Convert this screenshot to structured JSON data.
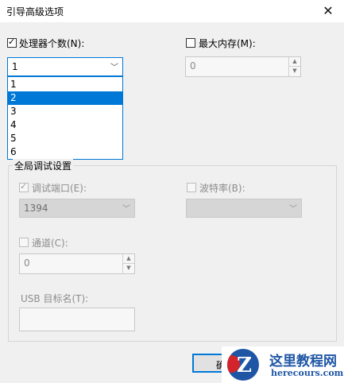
{
  "window": {
    "title": "引导高级选项",
    "close_glyph": "✕"
  },
  "processors": {
    "checkbox_label": "处理器个数(N):",
    "checked": true,
    "selected_value": "1",
    "options": [
      "1",
      "2",
      "3",
      "4",
      "5",
      "6"
    ],
    "highlighted_option": "2"
  },
  "max_memory": {
    "checkbox_label": "最大内存(M):",
    "checked": false,
    "value": "0"
  },
  "debug": {
    "group_title": "全局调试设置",
    "port_label": "调试端口(E):",
    "port_checked": true,
    "port_value": "1394",
    "baud_label": "波特率(B):",
    "baud_checked": false,
    "baud_value": "",
    "channel_label": "通道(C):",
    "channel_checked": false,
    "channel_value": "0",
    "usb_label": "USB 目标名(T):",
    "usb_value": ""
  },
  "buttons": {
    "ok_label": "确"
  },
  "watermark": {
    "title": "这里教程网",
    "url": "herecours.com",
    "logo_letter": "Z"
  },
  "colors": {
    "accent": "#0078d7",
    "watermark_blue": "#1e56a5",
    "watermark_red": "#d3242b"
  }
}
